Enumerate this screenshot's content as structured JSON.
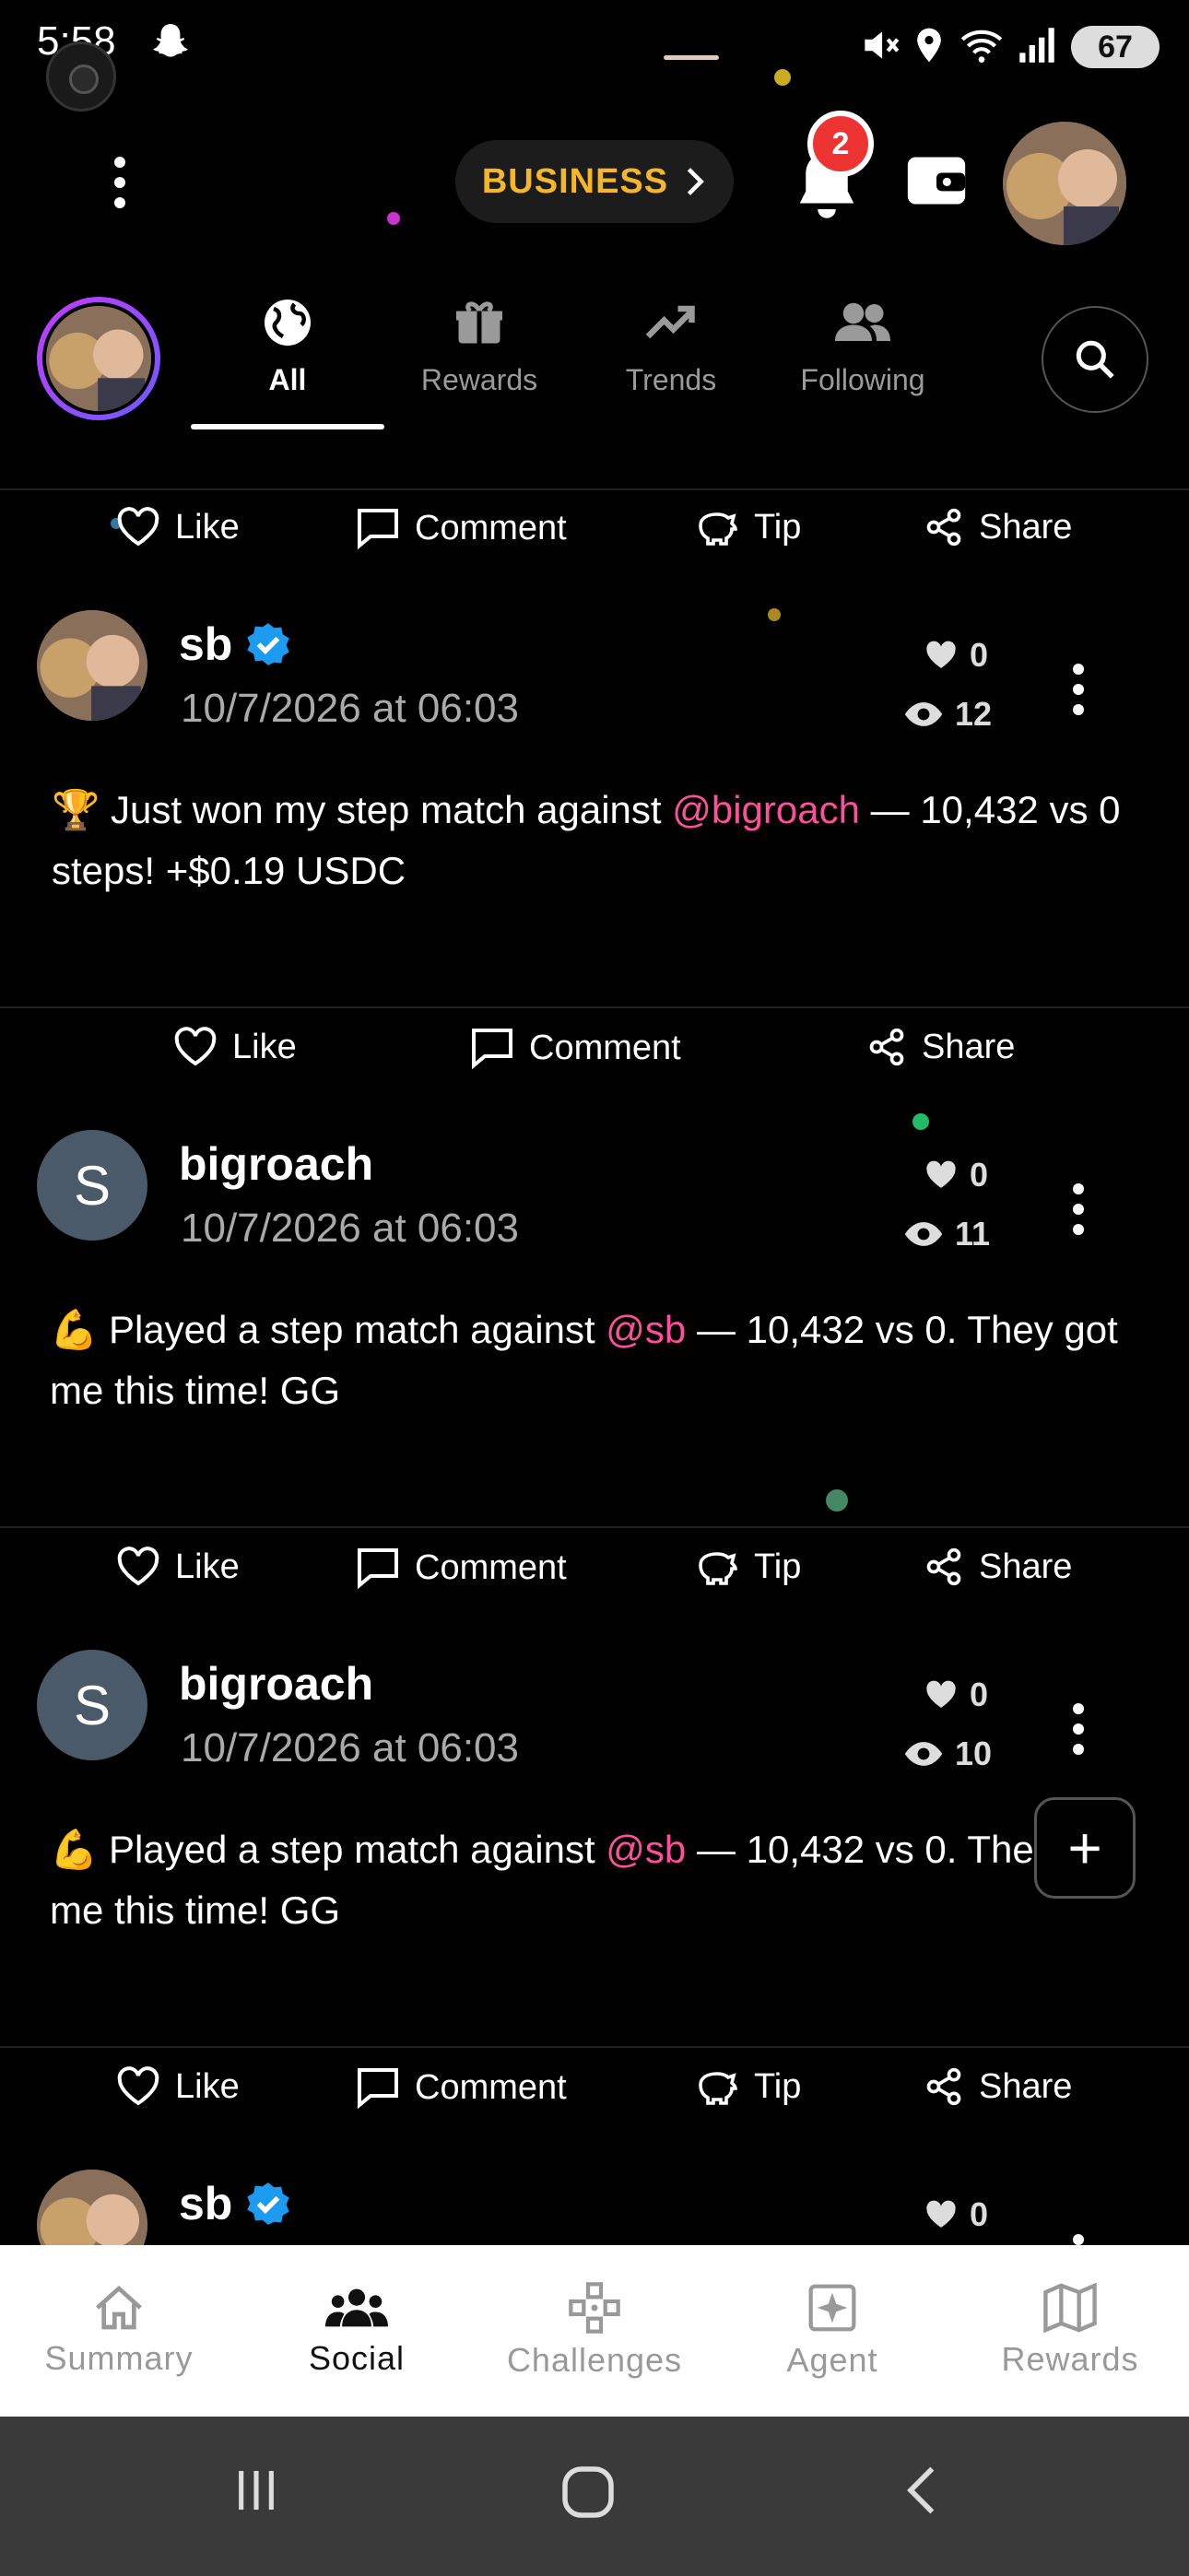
{
  "status_bar": {
    "time": "5:58",
    "battery": "67"
  },
  "header": {
    "business_label": "BUSINESS",
    "notification_count": "2"
  },
  "tabs": [
    {
      "label": "All",
      "icon": "globe-icon",
      "active": true
    },
    {
      "label": "Rewards",
      "icon": "gift-icon",
      "active": false
    },
    {
      "label": "Trends",
      "icon": "trending-up-icon",
      "active": false
    },
    {
      "label": "Following",
      "icon": "people-icon",
      "active": false
    }
  ],
  "actions": {
    "like": "Like",
    "comment": "Comment",
    "tip": "Tip",
    "share": "Share"
  },
  "posts": [
    {
      "username": "sb",
      "verified": true,
      "date": "10/7/2026 at 06:03",
      "likes": "0",
      "views": "12",
      "emoji": "🏆",
      "text_before": " Just won my step match against ",
      "mention": "@bigroach",
      "text_after": " — 10,432 vs 0 steps! +$0.19 USDC"
    },
    {
      "username": "bigroach",
      "avatar_letter": "S",
      "date": "10/7/2026 at 06:03",
      "likes": "0",
      "views": "11",
      "emoji": "💪",
      "text_before": " Played a step match against ",
      "mention": "@sb",
      "text_after": " — 10,432 vs 0. They got me this time! GG"
    },
    {
      "username": "bigroach",
      "avatar_letter": "S",
      "date": "10/7/2026 at 06:03",
      "likes": "0",
      "views": "10",
      "emoji": "💪",
      "text_before": " Played a step match against ",
      "mention": "@sb",
      "text_after": " — 10,432 vs 0. They got me this time! GG"
    },
    {
      "username": "sb",
      "verified": true,
      "likes": "0"
    }
  ],
  "fab_label": "+",
  "bottom_nav": [
    {
      "label": "Summary",
      "icon": "home-icon",
      "active": false
    },
    {
      "label": "Social",
      "icon": "group-icon",
      "active": true
    },
    {
      "label": "Challenges",
      "icon": "gamepad-icon",
      "active": false
    },
    {
      "label": "Agent",
      "icon": "sparkle-icon",
      "active": false
    },
    {
      "label": "Rewards",
      "icon": "map-icon",
      "active": false
    }
  ],
  "colors": {
    "accent": "#f5b629",
    "mention": "#ff4f9a",
    "verified": "#1d9bf0",
    "badge": "#ee3333"
  }
}
